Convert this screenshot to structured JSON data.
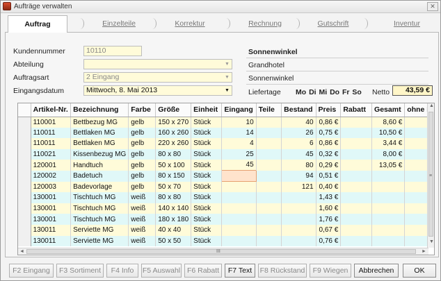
{
  "window": {
    "title": "Aufträge verwalten",
    "close": "✕"
  },
  "tabs": [
    {
      "label": "Auftrag",
      "active": true
    },
    {
      "label": "Einzelteile"
    },
    {
      "label": "Korrektur"
    },
    {
      "label": "Rechnung"
    },
    {
      "label": "Gutschrift"
    },
    {
      "label": "Inventur"
    }
  ],
  "form": {
    "kundennummer_label": "Kundennummer",
    "kundennummer_value": "10110",
    "abteilung_label": "Abteilung",
    "abteilung_value": "",
    "auftragsart_label": "Auftragsart",
    "auftragsart_value": "2  Eingang",
    "eingangsdatum_label": "Eingangsdatum",
    "eingangsdatum_value": "Mittwoch, 8. Mai 2013"
  },
  "customer": {
    "name": "Sonnenwinkel",
    "line1": "Grandhotel",
    "line2": "Sonnenwinkel",
    "liefertage_label": "Liefertage",
    "liefertage_value": "Mo Di Mi Do Fr So",
    "netto_label": "Netto",
    "netto_value": "43,59 €"
  },
  "table": {
    "columns": [
      "Artikel-Nr.",
      "Bezeichnung",
      "Farbe",
      "Größe",
      "Einheit",
      "Eingang",
      "Teile",
      "Bestand",
      "Preis",
      "Rabatt",
      "Gesamt",
      "ohne B"
    ],
    "rows": [
      [
        "110001",
        "Bettbezug MG",
        "gelb",
        "150 x 270",
        "Stück",
        "10",
        "",
        "40",
        "0,86 €",
        "",
        "8,60 €",
        ""
      ],
      [
        "110011",
        "Bettlaken MG",
        "gelb",
        "160 x 260",
        "Stück",
        "14",
        "",
        "26",
        "0,75 €",
        "",
        "10,50 €",
        ""
      ],
      [
        "110011",
        "Bettlaken MG",
        "gelb",
        "220 x 260",
        "Stück",
        "4",
        "",
        "6",
        "0,86 €",
        "",
        "3,44 €",
        ""
      ],
      [
        "110021",
        "Kissenbezug MG",
        "gelb",
        "80 x 80",
        "Stück",
        "25",
        "",
        "45",
        "0,32 €",
        "",
        "8,00 €",
        ""
      ],
      [
        "120001",
        "Handtuch",
        "gelb",
        "50 x 100",
        "Stück",
        "45",
        "",
        "80",
        "0,29 €",
        "",
        "13,05 €",
        ""
      ],
      [
        "120002",
        "Badetuch",
        "gelb",
        "80 x 150",
        "Stück",
        "",
        "",
        "94",
        "0,51 €",
        "",
        "",
        ""
      ],
      [
        "120003",
        "Badevorlage",
        "gelb",
        "50 x 70",
        "Stück",
        "",
        "",
        "121",
        "0,40 €",
        "",
        "",
        ""
      ],
      [
        "130001",
        "Tischtuch MG",
        "weiß",
        "80 x 80",
        "Stück",
        "",
        "",
        "",
        "1,43 €",
        "",
        "",
        ""
      ],
      [
        "130001",
        "Tischtuch MG",
        "weiß",
        "140 x 140",
        "Stück",
        "",
        "",
        "",
        "1,60 €",
        "",
        "",
        ""
      ],
      [
        "130001",
        "Tischtuch MG",
        "weiß",
        "180 x 180",
        "Stück",
        "",
        "",
        "",
        "1,76 €",
        "",
        "",
        ""
      ],
      [
        "130011",
        "Serviette MG",
        "weiß",
        "40 x 40",
        "Stück",
        "",
        "",
        "",
        "0,67 €",
        "",
        "",
        ""
      ],
      [
        "130011",
        "Serviette MG",
        "weiß",
        "50 x 50",
        "Stück",
        "",
        "",
        "",
        "0,76 €",
        "",
        "",
        ""
      ]
    ]
  },
  "buttons": [
    {
      "label": "F2 Eingang"
    },
    {
      "label": "F3 Sortiment"
    },
    {
      "label": "F4 Info"
    },
    {
      "label": "F5 Auswahl"
    },
    {
      "label": "F6 Rabatt"
    },
    {
      "label": "F7 Text"
    },
    {
      "label": "F8 Rückstand"
    },
    {
      "label": "F9 Wiegen"
    },
    {
      "label": "Abbrechen"
    },
    {
      "label": "OK"
    }
  ],
  "scrollbar": {
    "mid_marker": "≡",
    "bottom_marker": "III"
  }
}
